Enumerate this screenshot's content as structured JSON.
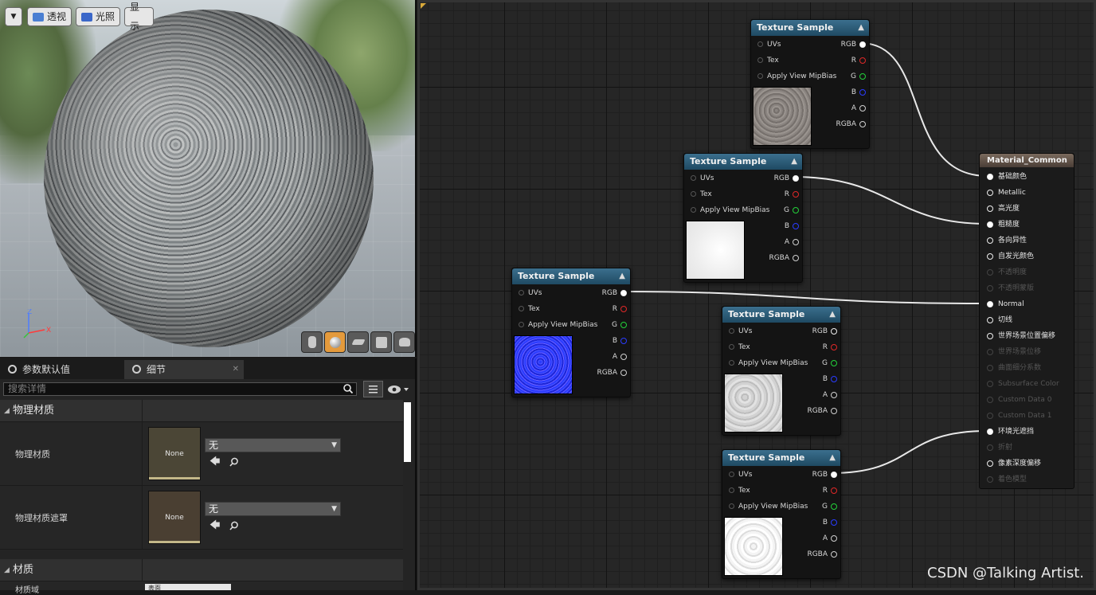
{
  "viewport": {
    "menu_icon": "chevron-down-icon",
    "perspective_label": "透视",
    "lit_label": "光照",
    "show_label": "显示",
    "axis": {
      "z": "Z",
      "x": "X"
    },
    "preview_tools": [
      "cylinder-icon",
      "sphere-icon",
      "plane-icon",
      "cube-icon",
      "teapot-icon"
    ],
    "active_preview_tool": "sphere-icon"
  },
  "details": {
    "tabs": [
      {
        "label": "参数默认值",
        "icon": "search-icon"
      },
      {
        "label": "细节",
        "icon": "search-icon"
      }
    ],
    "search_placeholder": "搜索详情",
    "categories": {
      "physical_material": "物理材质",
      "material": "材质"
    },
    "rows": [
      {
        "label": "物理材质",
        "thumb": "None",
        "value": "无"
      },
      {
        "label": "物理材质遮罩",
        "thumb": "None",
        "value": "无"
      }
    ],
    "partial_row": {
      "label": "材质域",
      "value": "表面"
    }
  },
  "graph": {
    "nodes": [
      {
        "title": "Texture Sample",
        "inputs": [
          "UVs",
          "Tex",
          "Apply View MipBias"
        ],
        "outputs": [
          "RGB",
          "R",
          "G",
          "B",
          "A",
          "RGBA"
        ],
        "preview": "gray-gravel-albedo"
      },
      {
        "title": "Texture Sample",
        "inputs": [
          "UVs",
          "Tex",
          "Apply View MipBias"
        ],
        "outputs": [
          "RGB",
          "R",
          "G",
          "B",
          "A",
          "RGBA"
        ],
        "preview": "white-roughness"
      },
      {
        "title": "Texture Sample",
        "inputs": [
          "UVs",
          "Tex",
          "Apply View MipBias"
        ],
        "outputs": [
          "RGB",
          "R",
          "G",
          "B",
          "A",
          "RGBA"
        ],
        "preview": "blue-normal"
      },
      {
        "title": "Texture Sample",
        "inputs": [
          "UVs",
          "Tex",
          "Apply View MipBias"
        ],
        "outputs": [
          "RGB",
          "R",
          "G",
          "B",
          "A",
          "RGBA"
        ],
        "preview": "gray-height"
      },
      {
        "title": "Texture Sample",
        "inputs": [
          "UVs",
          "Tex",
          "Apply View MipBias"
        ],
        "outputs": [
          "RGB",
          "R",
          "G",
          "B",
          "A",
          "RGBA"
        ],
        "preview": "white-ao"
      }
    ],
    "material": {
      "title": "Material_Common",
      "pins": [
        "基础颜色",
        "Metallic",
        "高光度",
        "粗糙度",
        "各向异性",
        "自发光颜色",
        "不透明度",
        "不透明蒙版",
        "Normal",
        "切线",
        "世界场景位置偏移",
        "世界场景位移",
        "曲面细分系数",
        "Subsurface Color",
        "Custom Data 0",
        "Custom Data 1",
        "环境光遮挡",
        "折射",
        "像素深度偏移",
        "着色模型"
      ],
      "connected": [
        "基础颜色",
        "粗糙度",
        "Normal",
        "环境光遮挡"
      ],
      "disabled": [
        "不透明度",
        "不透明蒙版",
        "世界场景位移",
        "曲面细分系数",
        "Subsurface Color",
        "Custom Data 0",
        "Custom Data 1",
        "折射",
        "着色模型"
      ]
    },
    "collapse_icon": "triangle-up-icon"
  },
  "watermark": "CSDN @Talking Artist.",
  "colors": {
    "node_header": "#2b5a77",
    "material_header": "#5e5046",
    "pin_red": "#e02828",
    "pin_green": "#23d23a",
    "pin_blue": "#2a3cff",
    "active_tool": "#e49a3c"
  }
}
